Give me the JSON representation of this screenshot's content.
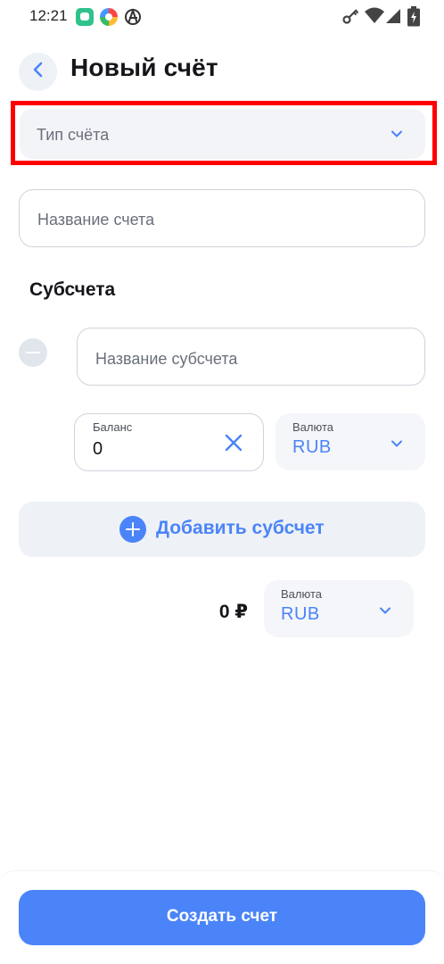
{
  "status_bar": {
    "time": "12:21",
    "icons": [
      "messenger-app-icon",
      "browser-app-icon",
      "anarchy-app-icon",
      "key-icon",
      "wifi-icon",
      "battery-icon"
    ]
  },
  "header": {
    "title": "Новый счёт",
    "back_icon": "chevron-left-icon"
  },
  "account_type": {
    "label": "Тип счёта",
    "icon": "chevron-down-icon"
  },
  "account_name": {
    "placeholder": "Название счета"
  },
  "subaccounts": {
    "title": "Субсчета",
    "items": [
      {
        "name_placeholder": "Название субсчета",
        "balance_label": "Баланс",
        "balance_value": "0",
        "currency_label": "Валюта",
        "currency_value": "RUB"
      }
    ],
    "add_button_label": "Добавить субсчет"
  },
  "total": {
    "amount": "0 ₽",
    "currency_label": "Валюта",
    "currency_value": "RUB"
  },
  "footer": {
    "create_button_label": "Создать счет"
  },
  "colors": {
    "accent": "#4a84f8",
    "highlight": "#ff0000",
    "field_bg": "#f2f4f8"
  }
}
